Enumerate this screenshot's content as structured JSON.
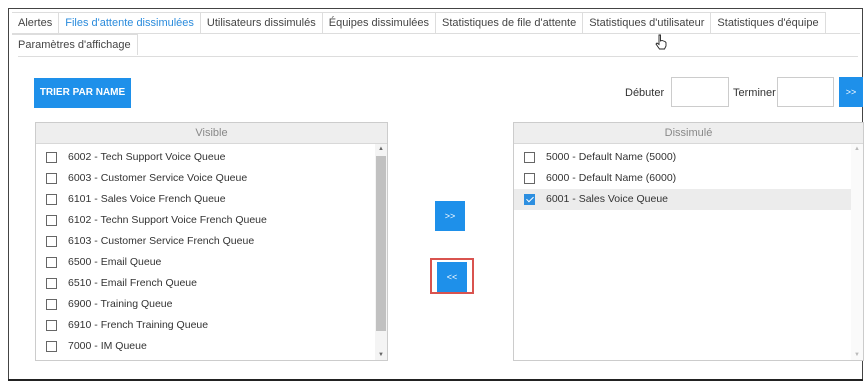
{
  "tabs": {
    "row1": [
      {
        "label": "Alertes",
        "active": false
      },
      {
        "label": "Files d'attente dissimulées",
        "active": true
      },
      {
        "label": "Utilisateurs dissimulés",
        "active": false
      },
      {
        "label": "Équipes dissimulées",
        "active": false
      },
      {
        "label": "Statistiques de file d'attente",
        "active": false
      },
      {
        "label": "Statistiques d'utilisateur",
        "active": false
      },
      {
        "label": "Statistiques d'équipe",
        "active": false
      }
    ],
    "row2": [
      {
        "label": "Paramètres d'affichage",
        "active": false
      }
    ]
  },
  "toolbar": {
    "sort_label": "TRIER PAR NAME",
    "start_label": "Débuter",
    "end_label": "Terminer",
    "start_value": "",
    "end_value": "",
    "go_label": ">>"
  },
  "visible_list": {
    "header": "Visible",
    "items": [
      {
        "label": "6002 - Tech Support Voice Queue",
        "checked": false
      },
      {
        "label": "6003 - Customer Service Voice Queue",
        "checked": false
      },
      {
        "label": "6101 - Sales Voice French Queue",
        "checked": false
      },
      {
        "label": "6102 - Techn Support Voice French Queue",
        "checked": false
      },
      {
        "label": "6103 - Customer Service French Queue",
        "checked": false
      },
      {
        "label": "6500 - Email Queue",
        "checked": false
      },
      {
        "label": "6510 - Email French Queue",
        "checked": false
      },
      {
        "label": "6900 - Training Queue",
        "checked": false
      },
      {
        "label": "6910 - French Training Queue",
        "checked": false
      },
      {
        "label": "7000 - IM Queue",
        "checked": false
      }
    ]
  },
  "hidden_list": {
    "header": "Dissimulé",
    "items": [
      {
        "label": "5000 - Default Name (5000)",
        "checked": false
      },
      {
        "label": "6000 - Default Name (6000)",
        "checked": false
      },
      {
        "label": "6001 - Sales Voice Queue",
        "checked": true
      }
    ]
  },
  "move": {
    "to_hidden_label": ">>",
    "to_visible_label": "<<"
  },
  "colors": {
    "accent": "#1e90ea",
    "highlight": "#d9534f",
    "active_tab": "#2a8bdc"
  }
}
